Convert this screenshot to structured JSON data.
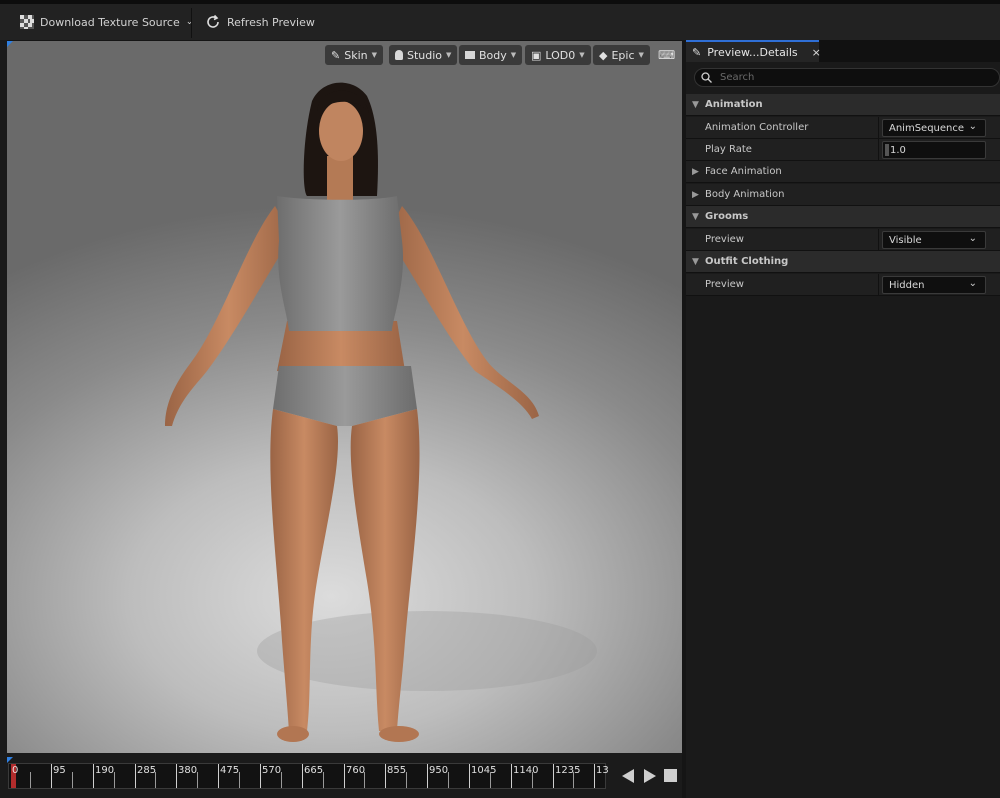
{
  "toolbar": {
    "download_label": "Download Texture Source",
    "refresh_label": "Refresh Preview"
  },
  "viewport": {
    "buttons": {
      "skin": "Skin",
      "studio": "Studio",
      "body": "Body",
      "lod": "LOD0",
      "quality": "Epic"
    }
  },
  "timeline": {
    "current_frame": "0",
    "ticks": [
      "95",
      "190",
      "285",
      "380",
      "475",
      "570",
      "665",
      "760",
      "855",
      "950",
      "1045",
      "1140",
      "1235",
      "13"
    ]
  },
  "panel": {
    "tab_label": "Preview...Details",
    "search_placeholder": "Search",
    "sections": {
      "animation": {
        "label": "Animation",
        "controller_label": "Animation Controller",
        "controller_value": "AnimSequence",
        "play_rate_label": "Play Rate",
        "play_rate_value": "1.0",
        "face_label": "Face Animation",
        "body_label": "Body Animation"
      },
      "grooms": {
        "label": "Grooms",
        "preview_label": "Preview",
        "preview_value": "Visible"
      },
      "outfit": {
        "label": "Outfit Clothing",
        "preview_label": "Preview",
        "preview_value": "Hidden"
      }
    }
  }
}
